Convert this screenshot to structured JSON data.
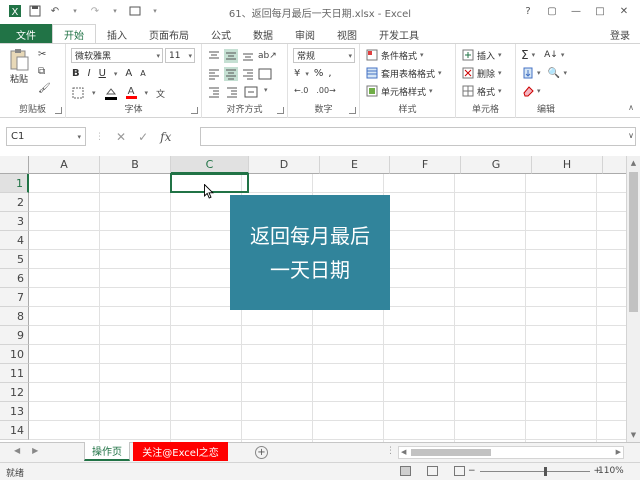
{
  "titlebar": {
    "doc_title": "61、返回每月最后一天日期.xlsx - Excel",
    "help": "?",
    "restore": "▢",
    "minimize": "—",
    "maximize": "□",
    "close": "✕"
  },
  "tabs": [
    "文件",
    "开始",
    "插入",
    "页面布局",
    "公式",
    "数据",
    "审阅",
    "视图",
    "开发工具"
  ],
  "login_label": "登录",
  "ribbon": {
    "clipboard": {
      "paste": "粘贴",
      "label": "剪贴板"
    },
    "font": {
      "name": "微软雅黑",
      "size": "11",
      "bold": "B",
      "italic": "I",
      "underline": "U",
      "grow": "A",
      "shrink": "A",
      "font_color": "A",
      "label": "字体"
    },
    "alignment": {
      "label": "对齐方式"
    },
    "number": {
      "format": "常规",
      "percent": "%",
      "comma": ",",
      "label": "数字"
    },
    "styles": {
      "conditional": "条件格式",
      "table": "套用表格格式",
      "cell": "单元格样式",
      "label": "样式"
    },
    "cells": {
      "insert": "插入",
      "delete": "删除",
      "format": "格式",
      "label": "单元格"
    },
    "editing": {
      "sum": "Σ",
      "sort": "A↓",
      "label": "编辑"
    }
  },
  "formula_bar": {
    "name_box": "C1",
    "cancel": "✕",
    "enter": "✓",
    "fx": "fx",
    "value": ""
  },
  "grid": {
    "columns": [
      "A",
      "B",
      "C",
      "D",
      "E",
      "F",
      "G",
      "H"
    ],
    "rows": [
      "1",
      "2",
      "3",
      "4",
      "5",
      "6",
      "7",
      "8",
      "9",
      "10",
      "11",
      "12",
      "13",
      "14"
    ],
    "selected_cell": "C1"
  },
  "shape": {
    "line1": "返回每月最后",
    "line2": "一天日期",
    "fill": "#31849b"
  },
  "sheets": [
    {
      "name": "操作页",
      "active": true
    },
    {
      "name": "关注@Excel之恋",
      "color": "#ff0000"
    }
  ],
  "status": {
    "ready": "就绪",
    "zoom": "110%",
    "zoom_out": "−",
    "zoom_in": "+"
  },
  "colors": {
    "accent": "#217346"
  }
}
